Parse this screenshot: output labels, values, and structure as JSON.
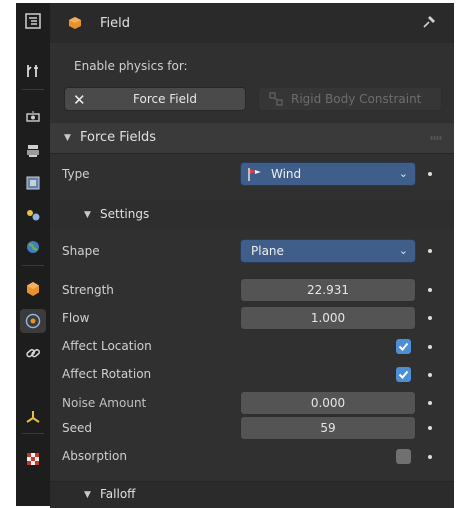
{
  "header": {
    "title": "Field",
    "pin_icon": "pin-icon"
  },
  "enable": {
    "label": "Enable physics for:"
  },
  "buttons": {
    "force_field": {
      "label": "Force Field",
      "icon": "x-icon"
    },
    "rigid_body": {
      "label": "Rigid Body Constraint",
      "icon": "rigid-body-constraint-icon"
    }
  },
  "force_fields": {
    "title": "Force Fields",
    "type": {
      "label": "Type",
      "value": "Wind",
      "icon": "wind-icon"
    },
    "settings": {
      "title": "Settings",
      "shape": {
        "label": "Shape",
        "value": "Plane"
      },
      "strength": {
        "label": "Strength",
        "value": "22.931"
      },
      "flow": {
        "label": "Flow",
        "value": "1.000"
      },
      "affect_location": {
        "label": "Affect Location",
        "checked": true
      },
      "affect_rotation": {
        "label": "Affect Rotation",
        "checked": true
      },
      "noise_amount": {
        "label": "Noise Amount",
        "value": "0.000"
      },
      "seed": {
        "label": "Seed",
        "value": "59"
      },
      "absorption": {
        "label": "Absorption",
        "checked": false
      }
    },
    "falloff": {
      "title": "Falloff"
    }
  },
  "sidebar": {
    "tabs": [
      "tool-icon",
      "render-icon",
      "output-icon",
      "view-layer-icon",
      "scene-icon",
      "world-icon",
      "object-icon",
      "physics-icon",
      "constraints-icon",
      "object-data-icon",
      "texture-icon",
      "editor-type-icon"
    ]
  },
  "colors": {
    "accent_blue": "#4d8fd6",
    "dropdown_blue": "#3f5e8a",
    "object_orange": "#e8922c"
  }
}
